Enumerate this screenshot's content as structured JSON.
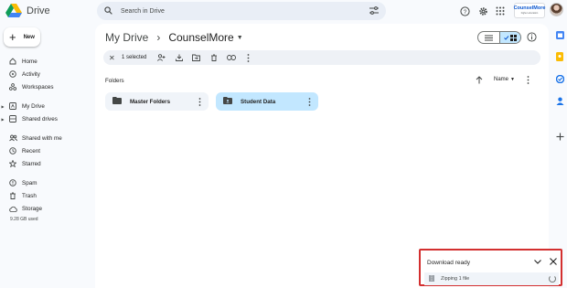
{
  "header": {
    "app_name": "Drive",
    "search_placeholder": "Search in Drive",
    "brand_name": "CounselMore",
    "brand_display": "CounselMore",
    "brand_tagline": "higher education",
    "icons": [
      "search-icon",
      "filter-options-icon",
      "help-icon",
      "settings-icon",
      "apps-grid-icon"
    ]
  },
  "sidebar": {
    "new_label": "New",
    "items": [
      {
        "label": "Home",
        "icon": "home-icon"
      },
      {
        "label": "Activity",
        "icon": "activity-icon"
      },
      {
        "label": "Workspaces",
        "icon": "workspaces-icon"
      },
      {
        "label": "My Drive",
        "icon": "my-drive-icon"
      },
      {
        "label": "Shared drives",
        "icon": "shared-drives-icon"
      },
      {
        "label": "Shared with me",
        "icon": "people-icon"
      },
      {
        "label": "Recent",
        "icon": "clock-icon"
      },
      {
        "label": "Starred",
        "icon": "star-icon"
      },
      {
        "label": "Spam",
        "icon": "spam-icon"
      },
      {
        "label": "Trash",
        "icon": "trash-icon"
      },
      {
        "label": "Storage",
        "icon": "cloud-icon"
      }
    ],
    "storage_used": "9.28 GB used"
  },
  "breadcrumb": {
    "root": "My Drive",
    "separator": "›",
    "current": "CounselMore"
  },
  "selection_bar": {
    "count_text": "1 selected",
    "actions": [
      "share-icon",
      "download-icon",
      "move-icon",
      "trash-icon",
      "link-icon",
      "more-vert-icon"
    ]
  },
  "content": {
    "section_title": "Folders",
    "sort_label": "Name",
    "folders": [
      {
        "name": "Master Folders",
        "selected": false
      },
      {
        "name": "Student Data",
        "selected": true
      }
    ]
  },
  "download_panel": {
    "title": "Download ready",
    "file_status": "Zipping 1 file"
  },
  "colors": {
    "selected_folder_bg": "#c2e7ff",
    "folder_bg": "#f0f4f9",
    "highlight_border": "#d32f2f",
    "accent": "#0b57d0"
  }
}
